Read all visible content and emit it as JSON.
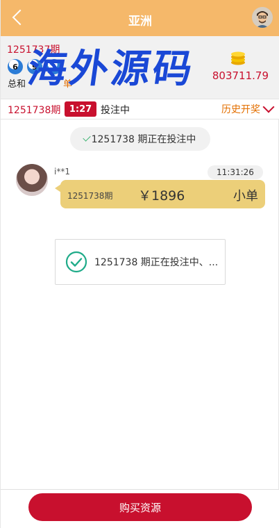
{
  "header": {
    "title": "亚洲"
  },
  "last_draw": {
    "period": "1251737期",
    "balls": [
      "6",
      "9",
      "1"
    ],
    "sum_label": "总和",
    "sum_tag": "单",
    "money": "803711.79"
  },
  "watermark": "海外源码",
  "current": {
    "period": "1251738期",
    "timer": "1:27",
    "status": "投注中",
    "history_label": "历史开奖"
  },
  "notice": {
    "text": "1251738 期正在投注中"
  },
  "message": {
    "username": "i**1",
    "time": "11:31:26",
    "period": "1251738期",
    "amount": "￥1896",
    "bet_type": "小单"
  },
  "toast": {
    "text": "1251738 期正在投注中、..."
  },
  "footer": {
    "buy_label": "购买资源"
  },
  "colors": {
    "header": "#f5b86a",
    "accent_red": "#c8102e",
    "bubble": "#eccf79",
    "orange": "#e36f00"
  }
}
